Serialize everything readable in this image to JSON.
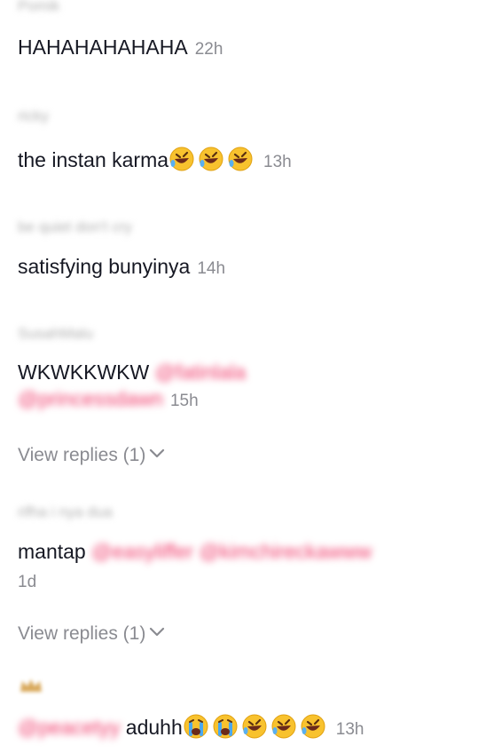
{
  "comments": [
    {
      "username": "Pomik",
      "text": "HAHAHAHAHAHA",
      "time": "22h"
    },
    {
      "username": "ricky",
      "text": "the instan karma",
      "emojis": [
        "rofl",
        "rofl",
        "rofl"
      ],
      "time": "13h"
    },
    {
      "username": "be quiet don't cry",
      "text": "satisfying bunyinya",
      "time": "14h"
    },
    {
      "username": "SusahMalu",
      "text": "WKWKKWKW",
      "mention1": "@fatinlala",
      "mention2": "@princessdawn",
      "time": "15h",
      "view_replies": "View replies (1)"
    },
    {
      "username": "rifha i nya dua",
      "text": "mantap",
      "mentions": "@easyliffer @kimchireckawww",
      "time": "1d",
      "view_replies": "View replies (1)"
    },
    {
      "username": "",
      "mention": "@peacetyy",
      "text": "aduhh",
      "emojis": [
        "sob",
        "sob",
        "rofl",
        "rofl",
        "rofl"
      ],
      "time": "13h"
    }
  ]
}
